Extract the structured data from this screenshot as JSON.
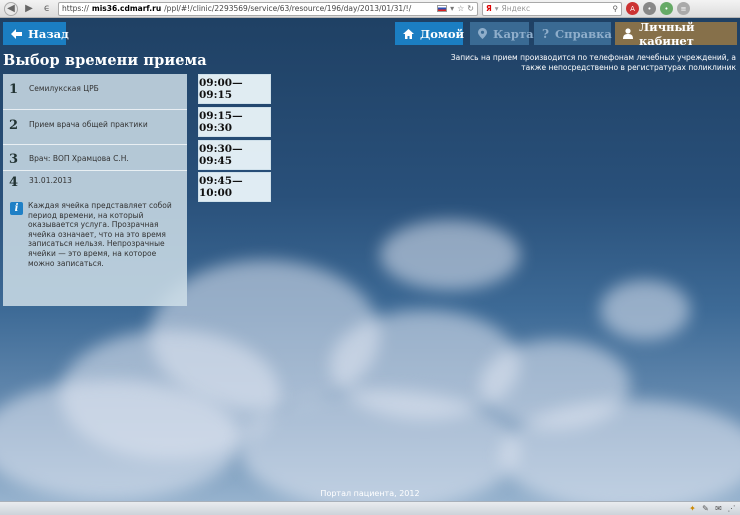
{
  "browser": {
    "url_prefix": "https://",
    "url_domain": "mis36.cdmarf.ru",
    "url_path": "/ppl/#!/clinic/2293569/service/63/resource/196/day/2013/01/31/!/",
    "search_placeholder": "Яндекс",
    "search_brand": "Я"
  },
  "header": {
    "back_label": "Назад",
    "home_label": "Домой",
    "map_label": "Карта",
    "help_label": "Справка",
    "cabinet_label": "Личный кабинет"
  },
  "page": {
    "title": "Выбор времени приема",
    "notice": "Запись на прием производится по телефонам лечебных учреждений, а также непосредственно в регистратурах поликлиник"
  },
  "steps": [
    {
      "num": "1",
      "text": "Семилукская ЦРБ"
    },
    {
      "num": "2",
      "text": "Прием врача общей практики"
    },
    {
      "num": "3",
      "text": "Врач: ВОП Храмцова С.Н."
    },
    {
      "num": "4",
      "text": "31.01.2013"
    }
  ],
  "hint": {
    "icon_glyph": "i",
    "text": "Каждая ячейка представляет собой период времени, на который оказывается услуга. Прозрачная ячейка означает, что на это время записаться нельзя. Непрозрачные ячейки — это время, на которое можно записаться."
  },
  "slots": [
    {
      "label": "09:00—09:15"
    },
    {
      "label": "09:15—09:30"
    },
    {
      "label": "09:30—09:45"
    },
    {
      "label": "09:45—10:00"
    }
  ],
  "footer": {
    "text": "Портал пациента, 2012"
  },
  "colors": {
    "accent_blue": "#1b7ec2",
    "disabled_blue": "#3a6a93",
    "cabinet_brown": "#86704a"
  }
}
